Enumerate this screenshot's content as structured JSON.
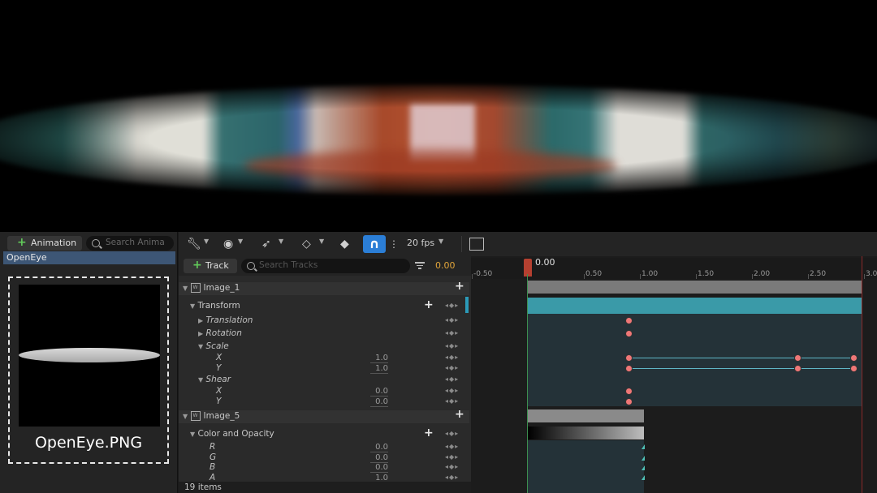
{
  "library": {
    "add_label": "Animation",
    "search_placeholder": "Search Anima",
    "selected_item": "OpenEye",
    "thumbnail_name": "OpenEye.PNG"
  },
  "toolbar": {
    "fps_label": "20 fps"
  },
  "tracks_bar": {
    "add_label": "Track",
    "search_placeholder": "Search Tracks",
    "time_value": "0.00"
  },
  "tree": {
    "image1": "Image_1",
    "transform": "Transform",
    "translation": "Translation",
    "rotation": "Rotation",
    "scale": "Scale",
    "scale_x_label": "X",
    "scale_x_value": "1.0",
    "scale_y_label": "Y",
    "scale_y_value": "1.0",
    "shear": "Shear",
    "shear_x_label": "X",
    "shear_x_value": "0.0",
    "shear_y_label": "Y",
    "shear_y_value": "0.0",
    "image5": "Image_5",
    "color_opacity": "Color and Opacity",
    "r_label": "R",
    "r_value": "0.0",
    "g_label": "G",
    "g_value": "0.0",
    "b_label": "B",
    "b_value": "0.0",
    "a_label": "A",
    "a_value": "1.0"
  },
  "status": {
    "items": "19 items"
  },
  "timeline": {
    "playhead": "0.00",
    "ticks": [
      "-0.50",
      "0.50",
      "1.00",
      "1.50",
      "2.00",
      "2.50",
      "3.0"
    ],
    "colors": {
      "keyframe": "#ef7777",
      "playhead": "#b54030",
      "track_lane": "#243238",
      "transform_bar": "#3a9aa8"
    }
  }
}
